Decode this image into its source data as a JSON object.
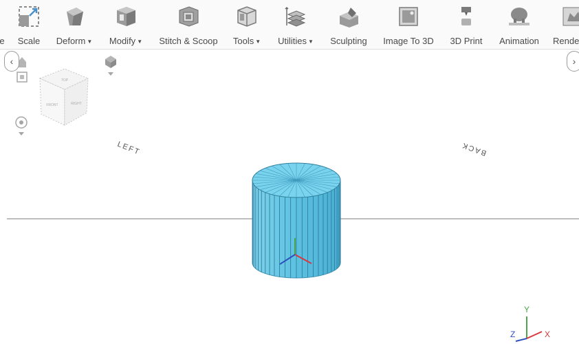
{
  "toolbar": {
    "items": [
      {
        "label": "e",
        "icon": "partial-tool-icon",
        "dropdown": false
      },
      {
        "label": "Scale",
        "icon": "scale-icon",
        "dropdown": false
      },
      {
        "label": "Deform",
        "icon": "deform-icon",
        "dropdown": true
      },
      {
        "label": "Modify",
        "icon": "modify-icon",
        "dropdown": true
      },
      {
        "label": "Stitch & Scoop",
        "icon": "stitch-scoop-icon",
        "dropdown": false
      },
      {
        "label": "Tools",
        "icon": "tools-icon",
        "dropdown": true
      },
      {
        "label": "Utilities",
        "icon": "utilities-icon",
        "dropdown": true
      },
      {
        "label": "Sculpting",
        "icon": "sculpting-icon",
        "dropdown": false
      },
      {
        "label": "Image To 3D",
        "icon": "image-to-3d-icon",
        "dropdown": false
      },
      {
        "label": "3D Print",
        "icon": "3d-print-icon",
        "dropdown": false
      },
      {
        "label": "Animation",
        "icon": "animation-icon",
        "dropdown": false
      },
      {
        "label": "Rende",
        "icon": "render-icon",
        "dropdown": false
      }
    ]
  },
  "viewport": {
    "labels": {
      "left": "LEFT",
      "back": "BACK"
    },
    "view_cube": {
      "top": "TOP",
      "front": "FRONT",
      "right": "RIGHT"
    },
    "axes": {
      "x": "X",
      "y": "Y",
      "z": "Z"
    },
    "object_color": "#6fd0ea"
  },
  "nav": {
    "left_arrow": "‹",
    "right_arrow": "›"
  }
}
